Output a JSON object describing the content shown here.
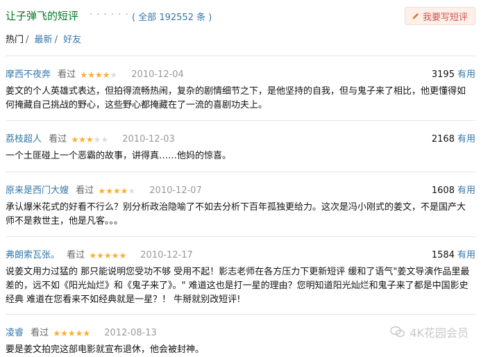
{
  "header": {
    "title": "让子弹飞的短评",
    "dots": "· · · · · ·",
    "total": "( 全部 192552 条 )",
    "write_label": "我要写短评"
  },
  "tabs": [
    {
      "label": "热门",
      "active": true
    },
    {
      "label": "最新",
      "active": false
    },
    {
      "label": "好友",
      "active": false
    }
  ],
  "tab_separator": "/",
  "reviews": [
    {
      "author": "摩西不夜奔",
      "seen": "看过",
      "rating": 4,
      "date": "2010-12-04",
      "votes": "3195",
      "useful": "有用",
      "content": "姜文的个人英雄式表达，但拍得流畅热闹，复杂的剧情细节之下，是他坚持的自我，但与鬼子来了相比，他更懂得如何掩藏自己挑战的野心，这些野心都掩藏在了一流的喜剧功夫上。"
    },
    {
      "author": "荔枝超人",
      "seen": "看过",
      "rating": 3,
      "date": "2010-12-03",
      "votes": "2168",
      "useful": "有用",
      "content": "一个土匪碰上一个恶霸的故事，讲得真……他妈的惊喜。"
    },
    {
      "author": "原来是西门大嫂",
      "seen": "看过",
      "rating": 4,
      "date": "2010-12-07",
      "votes": "1608",
      "useful": "有用",
      "content": "承认爆米花式的好看不行么？别分析政治隐喻了不如去分析下百年孤独更给力。这次是冯小刚式的姜文，不是国产大师不是救世主，他是凡客。。。"
    },
    {
      "author": "弗朗索瓦张。",
      "seen": "看过",
      "rating": 5,
      "date": "2010-12-17",
      "votes": "1584",
      "useful": "有用",
      "content": "说姜文用力过猛的 那只能说明您受功不够 受用不起！影志老师在各方压力下更新短评 缓和了语气\"姜文导演作品里最差的，远不如《阳光灿烂》和《鬼子来了》。\" 难道这也是打一星的理由？您明知道阳光灿烂和鬼子来了都是中国影史经典 难道在您看来不如经典就是一星？！ 牛掰就别改短评!"
    },
    {
      "author": "凌睿",
      "seen": "看过",
      "rating": 5,
      "date": "2012-08-13",
      "votes": "",
      "useful": "",
      "content": "要是姜文拍完这部电影就宣布退休，他会被封神。"
    }
  ],
  "watermark": "4K花园会员",
  "colors": {
    "link": "#3377aa",
    "title": "#007722",
    "star": "#ffac2d",
    "star_off": "#dddddd"
  }
}
